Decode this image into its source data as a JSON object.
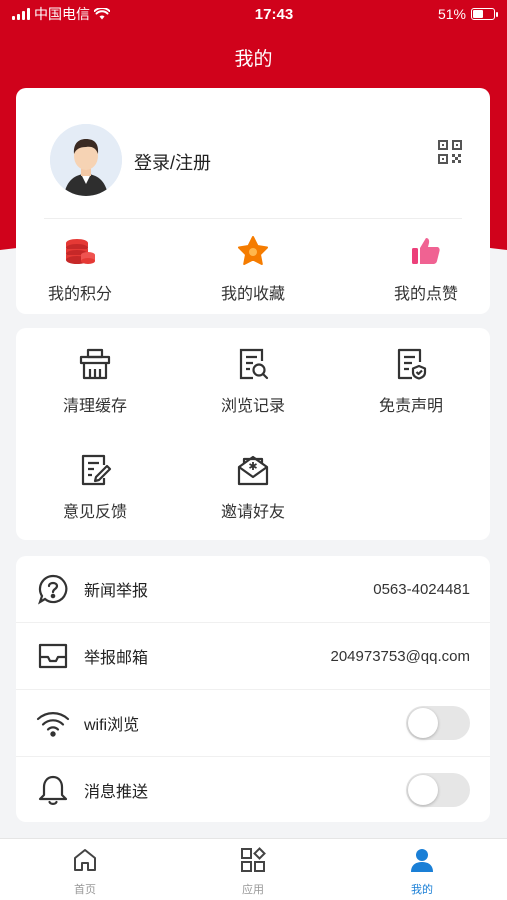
{
  "status_bar": {
    "carrier": "中国电信",
    "time": "17:43",
    "battery": "51%",
    "battery_level": 0.51
  },
  "header": {
    "title": "我的"
  },
  "profile": {
    "login_label": "登录/注册"
  },
  "stats": [
    {
      "label": "我的积分",
      "icon": "coins-icon",
      "color": "#e53935"
    },
    {
      "label": "我的收藏",
      "icon": "star-icon",
      "color": "#f57c00"
    },
    {
      "label": "我的点赞",
      "icon": "thumbs-up-icon",
      "color": "#ec407a"
    }
  ],
  "tools": [
    {
      "label": "清理缓存",
      "icon": "trash-icon"
    },
    {
      "label": "浏览记录",
      "icon": "history-icon"
    },
    {
      "label": "免责声明",
      "icon": "disclaimer-icon"
    },
    {
      "label": "意见反馈",
      "icon": "feedback-icon"
    },
    {
      "label": "邀请好友",
      "icon": "invite-icon"
    }
  ],
  "settings": [
    {
      "label": "新闻举报",
      "value": "0563-4024481",
      "icon": "help-icon"
    },
    {
      "label": "举报邮箱",
      "value": "204973753@qq.com",
      "icon": "inbox-icon"
    },
    {
      "label": "wifi浏览",
      "toggle": false,
      "icon": "wifi-icon"
    },
    {
      "label": "消息推送",
      "toggle": false,
      "icon": "bell-icon"
    }
  ],
  "tabbar": [
    {
      "label": "首页",
      "icon": "home-icon",
      "active": false
    },
    {
      "label": "应用",
      "icon": "apps-icon",
      "active": false
    },
    {
      "label": "我的",
      "icon": "user-icon",
      "active": true
    }
  ],
  "colors": {
    "brand": "#d0021b",
    "active_tab": "#1a7fd6"
  }
}
